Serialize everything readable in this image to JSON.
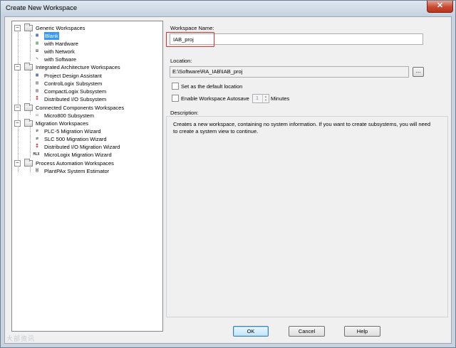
{
  "window": {
    "title": "Create New Workspace",
    "close_glyph": "✕"
  },
  "tree": {
    "groups": [
      {
        "label": "Generic Workspaces",
        "items": [
          {
            "label": "Blank",
            "icon": "blank-workspace-icon",
            "selected": true
          },
          {
            "label": "with Hardware",
            "icon": "hardware-icon"
          },
          {
            "label": "with Network",
            "icon": "network-icon"
          },
          {
            "label": "with Software",
            "icon": "software-icon"
          }
        ]
      },
      {
        "label": "Integrated Architecture Workspaces",
        "items": [
          {
            "label": "Project Design Assistant",
            "icon": "design-assistant-icon"
          },
          {
            "label": "ControlLogix Subsystem",
            "icon": "chassis-icon"
          },
          {
            "label": "CompactLogix Subsystem",
            "icon": "chassis-icon"
          },
          {
            "label": "Distributed I/O Subsystem",
            "icon": "io-icon"
          }
        ]
      },
      {
        "label": "Connected Components Workspaces",
        "items": [
          {
            "label": "Micro800 Subsystem",
            "icon": "micro-icon"
          }
        ]
      },
      {
        "label": "Migration Workspaces",
        "items": [
          {
            "label": "PLC-5 Migration Wizard",
            "icon": "migration-icon"
          },
          {
            "label": "SLC 500 Migration Wizard",
            "icon": "migration-icon"
          },
          {
            "label": "Distributed I/O Migration Wizard",
            "icon": "io-icon"
          },
          {
            "label": "MicroLogix Migration Wizard",
            "icon": "mlx-icon"
          }
        ]
      },
      {
        "label": "Process Automation Workspaces",
        "items": [
          {
            "label": "PlantPAx System Estimator",
            "icon": "estimator-icon"
          }
        ]
      }
    ]
  },
  "form": {
    "workspace_name_label": "Workspace Name:",
    "workspace_name_value": "IAB_proj",
    "location_label": "Location:",
    "location_value": "E:\\Software\\RA_IAB\\IAB_proj",
    "browse_label": "...",
    "default_location_label": "Set as the default location",
    "autosave_label": "Enable Workspace Autosave",
    "autosave_value": "1",
    "minutes_label": "Minutes",
    "description_label": "Description:",
    "description_line1": "Creates a new workspace, containing no system information. If you want to create subsystems, you will need",
    "description_line2": "to create a system view to continue."
  },
  "buttons": {
    "ok": "OK",
    "cancel": "Cancel",
    "help": "Help"
  },
  "watermark": "大部资讯"
}
